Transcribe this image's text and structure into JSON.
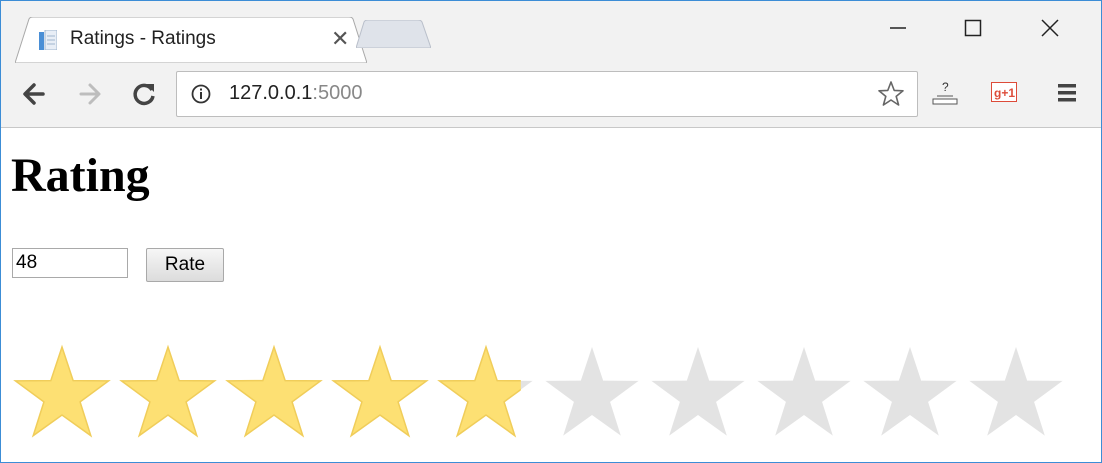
{
  "browser": {
    "tab_title": "Ratings - Ratings",
    "url_host": "127.0.0.1",
    "url_port": ":5000"
  },
  "page": {
    "heading": "Rating",
    "rating_input_value": "48",
    "rate_button_label": "Rate"
  },
  "rating": {
    "value": 48,
    "max": 100,
    "star_count": 10,
    "filled_color": "#fde073",
    "filled_stroke": "#f0cd5a",
    "empty_color": "#e3e3e3"
  },
  "icons": [
    "document-icon",
    "tab-close-icon",
    "minimize-icon",
    "maximize-icon",
    "close-window-icon",
    "back-arrow-icon",
    "forward-arrow-icon",
    "reload-icon",
    "info-icon",
    "bookmark-star-icon",
    "extension-icon",
    "google-plus-icon",
    "menu-icon"
  ]
}
